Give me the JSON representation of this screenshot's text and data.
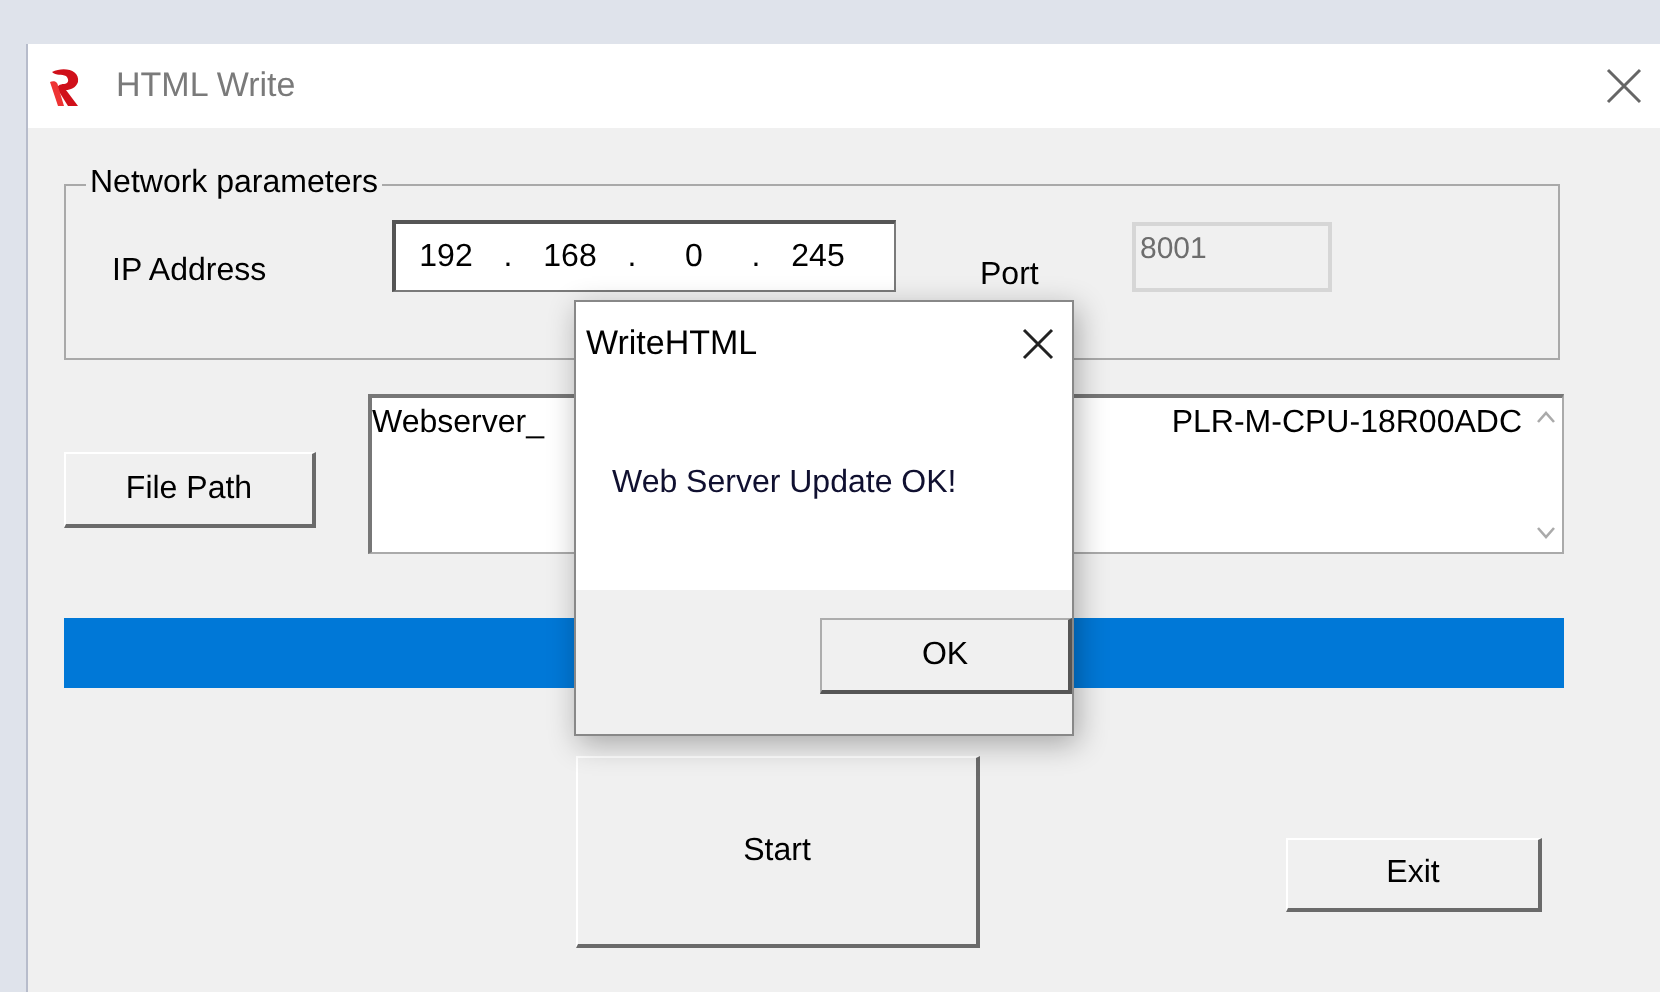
{
  "window": {
    "title": "HTML Write"
  },
  "network_group": {
    "label": "Network parameters",
    "ip_label": "IP Address",
    "ip_parts": [
      "192",
      ".",
      "168",
      ".",
      "0",
      ".",
      "245"
    ],
    "port_label": "Port",
    "port_value": "8001",
    "port_disabled": true
  },
  "file_path_button": "File Path",
  "path_field": {
    "value_start": "Webserver_",
    "value_end": "PLR-M-CPU-18R00ADC"
  },
  "progress": {
    "level": 1
  },
  "buttons": [
    {
      "label": "Start",
      "kind": "large"
    },
    {
      "label": "Exit",
      "kind": "small"
    }
  ],
  "dialog": {
    "title": "WriteHTML",
    "message": "Web Server Update OK!",
    "button": "OK"
  }
}
